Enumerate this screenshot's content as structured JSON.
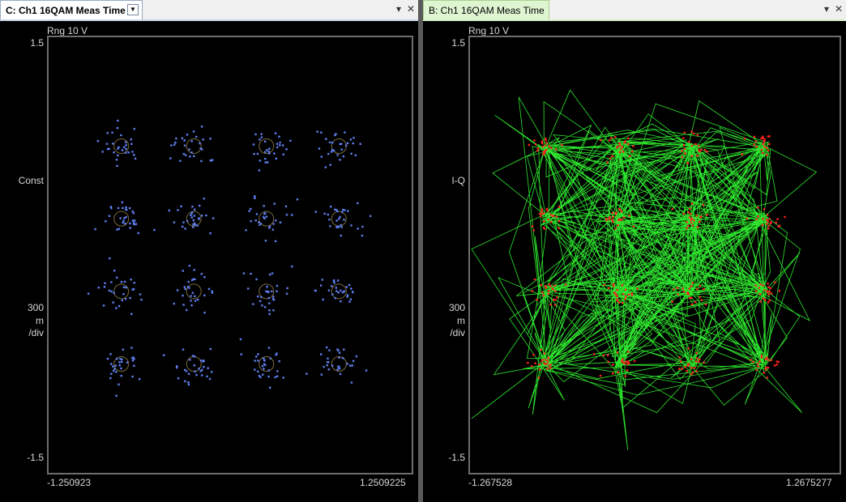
{
  "panes": {
    "left": {
      "tab_title": "C: Ch1 16QAM Meas Time",
      "range": "Rng 10  V",
      "y_top": "1.5",
      "y_bottom": "-1.5",
      "trace_label": "Const",
      "scale_value": "300",
      "scale_unit": "m",
      "scale_div": "/div",
      "x_min": "-1.250923",
      "x_max": "1.2509225",
      "trace_color": "#5f7ff0"
    },
    "right": {
      "tab_title": "B: Ch1 16QAM Meas Time",
      "range": "Rng 10  V",
      "y_top": "1.5",
      "y_bottom": "-1.5",
      "trace_label": "I-Q",
      "scale_value": "300",
      "scale_unit": "m",
      "scale_div": "/div",
      "x_min": "-1.267528",
      "x_max": "1.2675277",
      "trace_color": "#33ff33",
      "symbol_color": "#ff2020"
    }
  },
  "chart_data": [
    {
      "type": "scatter",
      "title": "",
      "xlabel": "",
      "ylabel": "Const",
      "xlim": [
        -1.250923,
        1.2509225
      ],
      "ylim": [
        -1.5,
        1.5
      ],
      "ideal_points": {
        "i": [
          -0.75,
          -0.25,
          0.25,
          0.75
        ],
        "q": [
          0.75,
          0.25,
          -0.25,
          -0.75
        ]
      }
    },
    {
      "type": "line",
      "title": "",
      "xlabel": "",
      "ylabel": "I-Q",
      "xlim": [
        -1.267528,
        1.2675277
      ],
      "ylim": [
        -1.5,
        1.5
      ],
      "ideal_points": {
        "i": [
          -0.75,
          -0.25,
          0.25,
          0.75
        ],
        "q": [
          0.75,
          0.25,
          -0.25,
          -0.75
        ]
      }
    }
  ]
}
